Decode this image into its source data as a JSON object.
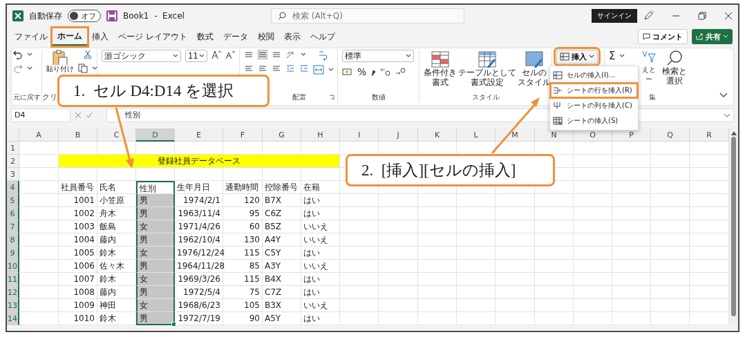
{
  "title_bar": {
    "autosave_label": "自動保存",
    "autosave": {
      "label": "オフ",
      "on": false
    },
    "document_title": "Book1  -  Excel",
    "search": {
      "placeholder": "検索 (Alt+Q)"
    },
    "sign_in": "サインイン"
  },
  "tabs": [
    {
      "label": "ファイル",
      "selected": false,
      "highlighted": false
    },
    {
      "label": "ホーム",
      "selected": true,
      "highlighted": true
    },
    {
      "label": "挿入",
      "selected": false,
      "highlighted": false
    },
    {
      "label": "ページ レイアウト",
      "selected": false,
      "highlighted": false
    },
    {
      "label": "数式",
      "selected": false,
      "highlighted": false
    },
    {
      "label": "データ",
      "selected": false,
      "highlighted": false
    },
    {
      "label": "校閲",
      "selected": false,
      "highlighted": false
    },
    {
      "label": "表示",
      "selected": false,
      "highlighted": false
    },
    {
      "label": "ヘルプ",
      "selected": false,
      "highlighted": false
    }
  ],
  "comment_button": "コメント",
  "share_button": "共有",
  "ribbon": {
    "undo_group": "元に戻す",
    "paste": "貼り付け",
    "clipboard_group": "クリ",
    "font": "游ゴシック",
    "font_size": "11",
    "alignment_group": "配置",
    "number_format": "標準",
    "percent": "%",
    "number_group": "数値",
    "styles": [
      {
        "lines": [
          "条件付き",
          "書式"
        ]
      },
      {
        "lines": [
          "テーブルとして",
          "書式設定"
        ]
      },
      {
        "lines": [
          "セルの",
          "スタイル"
        ]
      }
    ],
    "styles_group": "スタイル",
    "insert": {
      "label": "挿入",
      "highlighted": true
    },
    "sum": "Σ",
    "sort": [
      "えと",
      "ー"
    ],
    "find": [
      "検索と",
      "選択"
    ],
    "editing_group": "集"
  },
  "insert_menu": [
    {
      "kind": "cells",
      "label": "セルの挿入(I)...",
      "highlighted": false
    },
    {
      "kind": "rows",
      "label": "シートの行を挿入(R)",
      "highlighted": true
    },
    {
      "kind": "columns",
      "label": "シートの列を挿入(C)",
      "highlighted": false
    },
    {
      "kind": "sheet",
      "label": "シートの挿入(S)",
      "highlighted": false
    }
  ],
  "formula_bar": {
    "name_box": "D4",
    "formula": "性別"
  },
  "columns": [
    {
      "label": "A",
      "kind": "text",
      "selected": false
    },
    {
      "label": "B",
      "kind": "number",
      "selected": false
    },
    {
      "label": "C",
      "kind": "text",
      "selected": false
    },
    {
      "label": "D",
      "kind": "text",
      "selected": true
    },
    {
      "label": "E",
      "kind": "number",
      "selected": false
    },
    {
      "label": "F",
      "kind": "number",
      "selected": false
    },
    {
      "label": "G",
      "kind": "text",
      "selected": false
    },
    {
      "label": "H",
      "kind": "text",
      "selected": false
    },
    {
      "label": "I",
      "kind": "text",
      "selected": false
    },
    {
      "label": "J",
      "kind": "text",
      "selected": false
    },
    {
      "label": "K",
      "kind": "text",
      "selected": false
    },
    {
      "label": "L",
      "kind": "text",
      "selected": false
    },
    {
      "label": "M",
      "kind": "text",
      "selected": false
    },
    {
      "label": "N",
      "kind": "text",
      "selected": false
    },
    {
      "label": "O",
      "kind": "text",
      "selected": false
    },
    {
      "label": "P",
      "kind": "text",
      "selected": false
    },
    {
      "label": "Q",
      "kind": "text",
      "selected": false
    },
    {
      "label": "R",
      "kind": "text",
      "selected": false
    }
  ],
  "rows": [
    {
      "header": "1",
      "kind": "empty",
      "selected": false
    },
    {
      "header": "2",
      "kind": "banner",
      "selected": false,
      "text": "登録社員データベース"
    },
    {
      "header": "3",
      "kind": "empty",
      "selected": false
    },
    {
      "header": "4",
      "kind": "header",
      "selected": true,
      "cells": [
        "社員番号",
        "氏名",
        "性別",
        "生年月日",
        "通勤時間",
        "控除番号",
        "在籍"
      ]
    },
    {
      "header": "5",
      "kind": "data",
      "selected": true,
      "cells": [
        "1001",
        "小笠原",
        "男",
        "1974/2/1",
        "120",
        "B7X",
        "はい"
      ]
    },
    {
      "header": "6",
      "kind": "data",
      "selected": true,
      "cells": [
        "1002",
        "舟木",
        "男",
        "1963/11/4",
        "95",
        "C6Z",
        "はい"
      ]
    },
    {
      "header": "7",
      "kind": "data",
      "selected": true,
      "cells": [
        "1003",
        "飯島",
        "女",
        "1971/4/26",
        "60",
        "B5Z",
        "いいえ"
      ]
    },
    {
      "header": "8",
      "kind": "data",
      "selected": true,
      "cells": [
        "1004",
        "藤内",
        "男",
        "1962/10/4",
        "130",
        "A4Y",
        "いいえ"
      ]
    },
    {
      "header": "9",
      "kind": "data",
      "selected": true,
      "cells": [
        "1005",
        "鈴木",
        "女",
        "1976/12/24",
        "115",
        "C5Y",
        "はい"
      ]
    },
    {
      "header": "10",
      "kind": "data",
      "selected": true,
      "cells": [
        "1006",
        "佐々木",
        "男",
        "1964/11/28",
        "85",
        "A3Y",
        "いいえ"
      ]
    },
    {
      "header": "11",
      "kind": "data",
      "selected": true,
      "cells": [
        "1007",
        "鈴木",
        "女",
        "1969/3/26",
        "115",
        "B4X",
        "はい"
      ]
    },
    {
      "header": "12",
      "kind": "data",
      "selected": true,
      "cells": [
        "1008",
        "藤内",
        "男",
        "1972/5/4",
        "75",
        "C7Z",
        "はい"
      ]
    },
    {
      "header": "13",
      "kind": "data",
      "selected": true,
      "cells": [
        "1009",
        "神田",
        "女",
        "1968/6/23",
        "105",
        "B3X",
        "いいえ"
      ]
    },
    {
      "header": "14",
      "kind": "data",
      "selected": true,
      "cells": [
        "1010",
        "鈴木",
        "男",
        "1972/7/19",
        "90",
        "A5Y",
        "はい"
      ]
    }
  ],
  "callouts": [
    {
      "text": "1.  セル D4:D14 を選択"
    },
    {
      "text": "2.  [挿入][セルの挿入]"
    }
  ]
}
